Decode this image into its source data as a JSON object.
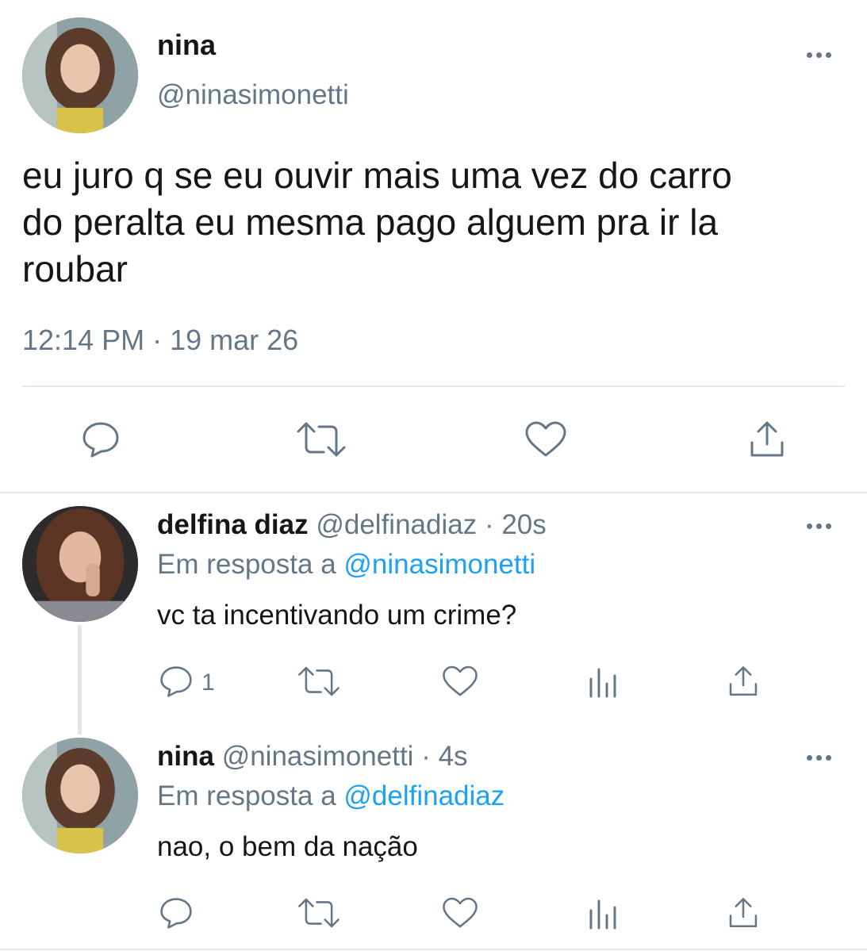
{
  "main_tweet": {
    "display_name": "nina",
    "handle": "@ninasimonetti",
    "text_lines": [
      "eu juro q se eu ouvir mais uma vez do carro",
      "do peralta eu mesma pago alguem pra ir la",
      "roubar"
    ],
    "timestamp": "12:14 PM · 19 mar 26",
    "actions": [
      "reply-icon",
      "retweet-icon",
      "like-icon",
      "share-icon"
    ]
  },
  "replies": [
    {
      "display_name": "delfina diaz",
      "handle": "@delfinadiaz",
      "time": "· 20s",
      "reply_prefix": "Em resposta a",
      "reply_to": "@ninasimonetti",
      "text": "vc ta incentivando um crime?",
      "reply_count": "1"
    },
    {
      "display_name": "nina",
      "handle": "@ninasimonetti",
      "time": "· 4s",
      "reply_prefix": "Em resposta a",
      "reply_to": "@delfinadiaz",
      "text": "nao, o bem da nação",
      "reply_count": ""
    }
  ],
  "colors": {
    "text": "#14171a",
    "muted": "#657786",
    "link": "#1da1f2",
    "divider": "#e1e8ed"
  }
}
